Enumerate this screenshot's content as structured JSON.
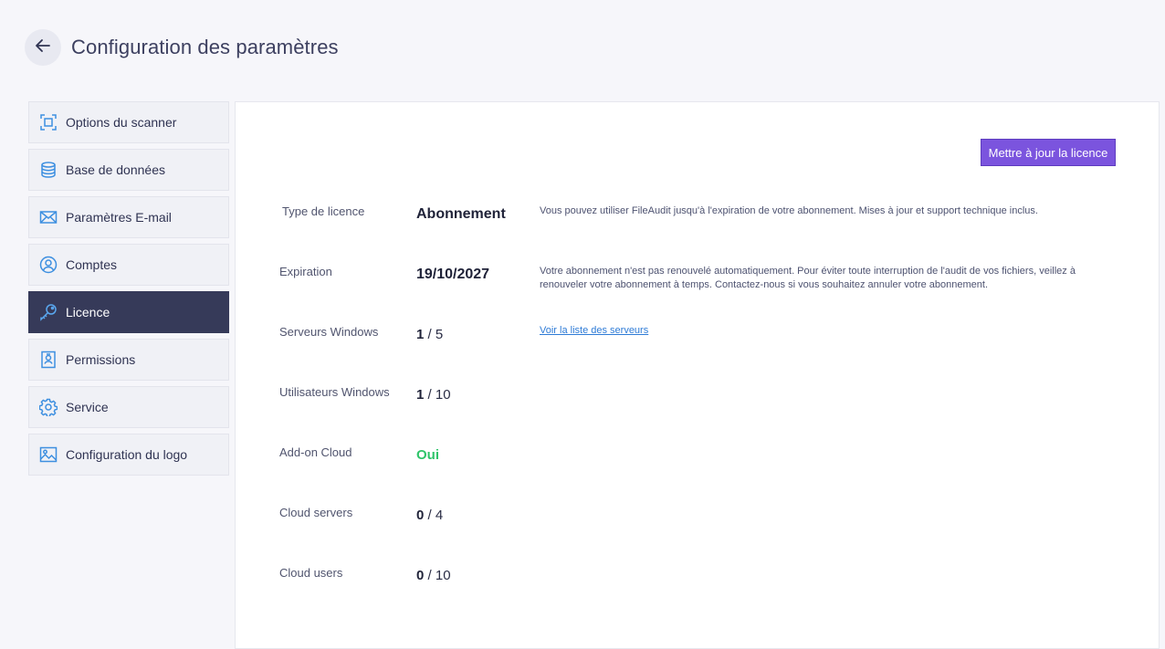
{
  "header": {
    "title": "Configuration des paramètres",
    "back_icon": "arrow-left-icon"
  },
  "sidebar": {
    "items": [
      {
        "label": "Options du scanner",
        "icon": "scanner-frame-icon",
        "active": false
      },
      {
        "label": "Base de données",
        "icon": "database-icon",
        "active": false
      },
      {
        "label": "Paramètres E-mail",
        "icon": "envelope-icon",
        "active": false
      },
      {
        "label": "Comptes",
        "icon": "user-circle-icon",
        "active": false
      },
      {
        "label": "Licence",
        "icon": "key-icon",
        "active": true
      },
      {
        "label": "Permissions",
        "icon": "badge-icon",
        "active": false
      },
      {
        "label": "Service",
        "icon": "gear-icon",
        "active": false
      },
      {
        "label": "Configuration du logo",
        "icon": "image-icon",
        "active": false
      }
    ]
  },
  "license": {
    "update_button": "Mettre à jour la licence",
    "rows": {
      "type": {
        "label": "Type de licence",
        "value": "Abonnement",
        "description": "Vous pouvez utiliser FileAudit jusqu'à l'expiration de votre abonnement. Mises à jour et support technique inclus."
      },
      "expiration": {
        "label": "Expiration",
        "value": "19/10/2027",
        "description": "Votre abonnement n'est pas renouvelé automatiquement. Pour éviter toute interruption de l'audit de vos fichiers, veillez à renouveler votre abonnement à temps. Contactez-nous si vous souhaitez annuler votre abonnement."
      },
      "windows_servers": {
        "label": "Serveurs Windows",
        "used": "1",
        "total": "/ 5",
        "link": "Voir la liste des serveurs"
      },
      "windows_users": {
        "label": "Utilisateurs Windows",
        "used": "1",
        "total": "/ 10"
      },
      "cloud_addon": {
        "label": "Add-on Cloud",
        "value": "Oui"
      },
      "cloud_servers": {
        "label": "Cloud servers",
        "used": "0",
        "total": "/ 4"
      },
      "cloud_users": {
        "label": "Cloud users",
        "used": "0",
        "total": "/ 10"
      }
    }
  },
  "colors": {
    "accent": "#7b54de",
    "active_nav": "#363a59",
    "icon_blue": "#3d8fe0",
    "success": "#2fc46a",
    "link": "#2e7bd6"
  }
}
